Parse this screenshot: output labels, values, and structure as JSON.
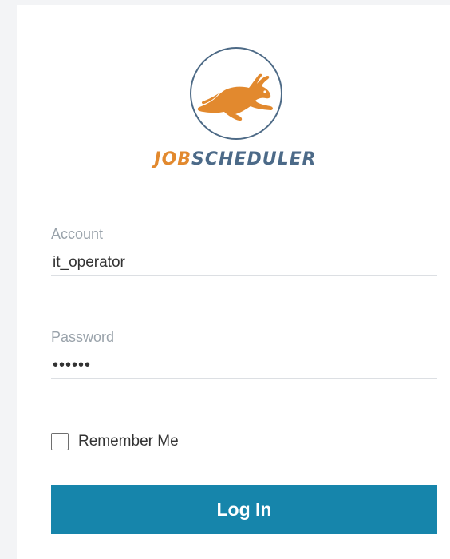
{
  "brand": {
    "logo_icon": "rabbit-icon",
    "name_part1": "JOB",
    "name_part2": "SCHEDULER",
    "accent_color": "#e2892e",
    "secondary_color": "#4c6a88"
  },
  "form": {
    "account": {
      "label": "Account",
      "value": "it_operator"
    },
    "password": {
      "label": "Password",
      "value": "••••••"
    },
    "remember_me": {
      "label": "Remember Me",
      "checked": false
    },
    "submit_label": "Log In",
    "button_color": "#1685ab"
  }
}
